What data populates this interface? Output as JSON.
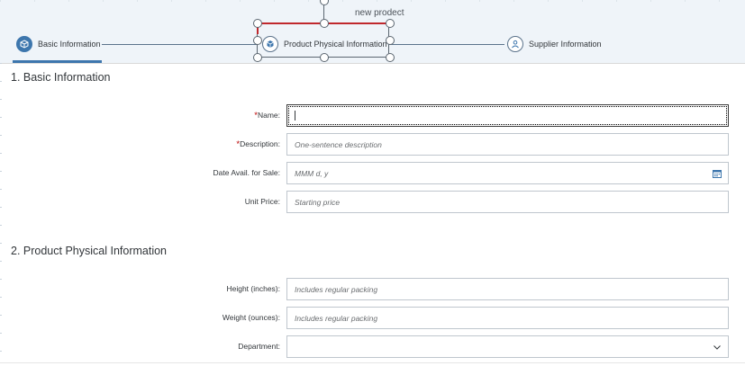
{
  "header": {
    "selection_label": "new prodect",
    "steps": [
      {
        "label": "Basic Information",
        "icon": "cube-icon",
        "state": "active"
      },
      {
        "label": "Product Physical Information",
        "icon": "cubes-icon",
        "state": "inactive"
      },
      {
        "label": "Supplier Information",
        "icon": "supplier-icon",
        "state": "inactive"
      }
    ]
  },
  "sections": [
    {
      "title": "1. Basic Information"
    },
    {
      "title": "2. Product Physical Information"
    }
  ],
  "fields": {
    "name": {
      "required_mark": "*",
      "label": "Name:",
      "value": "",
      "placeholder": ""
    },
    "description": {
      "required_mark": "*",
      "label": "Description:",
      "placeholder": "One-sentence description"
    },
    "date": {
      "label": "Date Avail. for Sale:",
      "placeholder": "MMM d, y",
      "icon": "calendar-icon"
    },
    "price": {
      "label": "Unit Price:",
      "placeholder": "Starting price"
    },
    "height": {
      "label": "Height (inches):",
      "placeholder": "Includes regular packing"
    },
    "weight": {
      "label": "Weight (ounces):",
      "placeholder": "Includes regular packing"
    },
    "department": {
      "label": "Department:",
      "value": "",
      "icon": "chevron-down-icon"
    }
  },
  "colors": {
    "accent": "#3d76ad",
    "required": "#bb0000",
    "selection_red": "#c0282d"
  }
}
